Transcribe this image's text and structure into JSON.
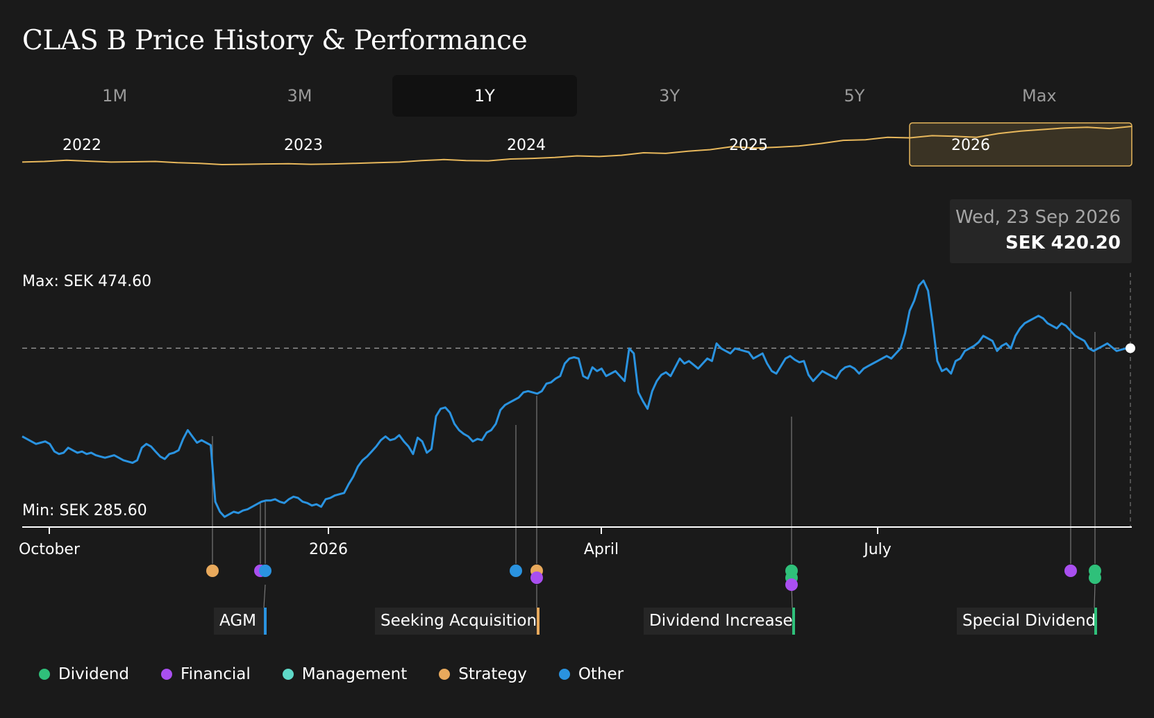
{
  "title": "CLAS B Price History & Performance",
  "tabs": [
    {
      "label": "1M",
      "active": false
    },
    {
      "label": "3M",
      "active": false
    },
    {
      "label": "1Y",
      "active": true
    },
    {
      "label": "3Y",
      "active": false
    },
    {
      "label": "5Y",
      "active": false
    },
    {
      "label": "Max",
      "active": false
    }
  ],
  "tooltip": {
    "date": "Wed, 23 Sep 2026",
    "price": "SEK 420.20"
  },
  "colors": {
    "price_line": "#2a93e0",
    "overview_line": "#e8b85c",
    "dividend": "#2fc07a",
    "financial": "#a94ff0",
    "management": "#5fd9c8",
    "strategy": "#e8a95c",
    "other": "#2a93e0"
  },
  "legend": [
    {
      "label": "Dividend",
      "color": "#2fc07a"
    },
    {
      "label": "Financial",
      "color": "#a94ff0"
    },
    {
      "label": "Management",
      "color": "#5fd9c8"
    },
    {
      "label": "Strategy",
      "color": "#e8a95c"
    },
    {
      "label": "Other",
      "color": "#2a93e0"
    }
  ],
  "event_labels": [
    {
      "label": "AGM",
      "category": "other"
    },
    {
      "label": "Seeking Acquisition",
      "category": "strategy"
    },
    {
      "label": "Dividend Increase",
      "category": "dividend"
    },
    {
      "label": "Special Dividend",
      "category": "dividend"
    }
  ],
  "chart_data": {
    "type": "line",
    "currency": "SEK",
    "max_label": "Max: SEK 474.60",
    "min_label": "Min: SEK 285.60",
    "y_max": 474.6,
    "y_min": 285.6,
    "current_value": 420.2,
    "x_ticks": [
      "October",
      "2026",
      "April",
      "July"
    ],
    "overview": {
      "year_labels": [
        "2022",
        "2023",
        "2024",
        "2025",
        "2026"
      ],
      "selected_range": "1Y",
      "values": [
        300,
        302,
        306,
        303,
        300,
        301,
        302,
        298,
        296,
        292,
        293,
        294,
        295,
        293,
        294,
        296,
        298,
        300,
        305,
        308,
        305,
        304,
        310,
        312,
        315,
        320,
        318,
        322,
        330,
        328,
        335,
        340,
        350,
        345,
        348,
        352,
        360,
        370,
        372,
        380,
        378,
        385,
        383,
        380,
        392,
        400,
        405,
        410,
        412,
        408,
        415
      ]
    },
    "series": [
      {
        "values": [
          350,
          348,
          346,
          344,
          345,
          346,
          344,
          338,
          336,
          337,
          341,
          339,
          337,
          338,
          336,
          337,
          335,
          334,
          333,
          334,
          335,
          333,
          331,
          330,
          329,
          331,
          341,
          344,
          342,
          338,
          334,
          332,
          336,
          337,
          339,
          348,
          355,
          350,
          345,
          347,
          345,
          343,
          298,
          290,
          286,
          288,
          290,
          289,
          291,
          292,
          294,
          296,
          298,
          299,
          299,
          300,
          298,
          297,
          300,
          302,
          301,
          298,
          297,
          295,
          296,
          294,
          300,
          301,
          303,
          304,
          305,
          312,
          318,
          326,
          331,
          334,
          338,
          342,
          347,
          350,
          347,
          348,
          351,
          346,
          342,
          336,
          349,
          346,
          337,
          340,
          366,
          372,
          373,
          369,
          360,
          355,
          352,
          350,
          346,
          348,
          347,
          353,
          355,
          360,
          371,
          375,
          377,
          379,
          381,
          385,
          386,
          385,
          384,
          386,
          392,
          393,
          396,
          398,
          408,
          412,
          413,
          412,
          398,
          396,
          405,
          402,
          404,
          398,
          400,
          402,
          398,
          394,
          420,
          416,
          385,
          378,
          372,
          386,
          394,
          399,
          401,
          398,
          405,
          412,
          408,
          410,
          407,
          404,
          408,
          412,
          410,
          424,
          420,
          418,
          416,
          420,
          419,
          418,
          417,
          412,
          414,
          416,
          408,
          402,
          400,
          406,
          412,
          414,
          411,
          409,
          410,
          399,
          394,
          398,
          402,
          400,
          398,
          396,
          402,
          405,
          406,
          404,
          400,
          404,
          406,
          408,
          410,
          412,
          414,
          412,
          416,
          420,
          432,
          450,
          458,
          470,
          474,
          466,
          440,
          410,
          402,
          404,
          400,
          410,
          412,
          418,
          420,
          422,
          425,
          430,
          428,
          426,
          418,
          422,
          424,
          420,
          430,
          436,
          440,
          442,
          444,
          446,
          444,
          440,
          438,
          436,
          440,
          438,
          434,
          430,
          428,
          426,
          420,
          418,
          420,
          422,
          424,
          421,
          418,
          419,
          420,
          420.2
        ]
      }
    ],
    "events": [
      {
        "category": "strategy",
        "date": "2025-11"
      },
      {
        "category": "financial",
        "date": "2025-12"
      },
      {
        "category": "other",
        "date": "2025-12"
      },
      {
        "category": "other",
        "date": "2026-03"
      },
      {
        "category": "strategy",
        "date": "2026-03"
      },
      {
        "category": "financial",
        "date": "2026-03"
      },
      {
        "category": "dividend",
        "date": "2026-05"
      },
      {
        "category": "dividend",
        "date": "2026-05"
      },
      {
        "category": "financial",
        "date": "2026-05"
      },
      {
        "category": "financial",
        "date": "2026-09"
      },
      {
        "category": "dividend",
        "date": "2026-09"
      },
      {
        "category": "dividend",
        "date": "2026-09"
      }
    ]
  }
}
